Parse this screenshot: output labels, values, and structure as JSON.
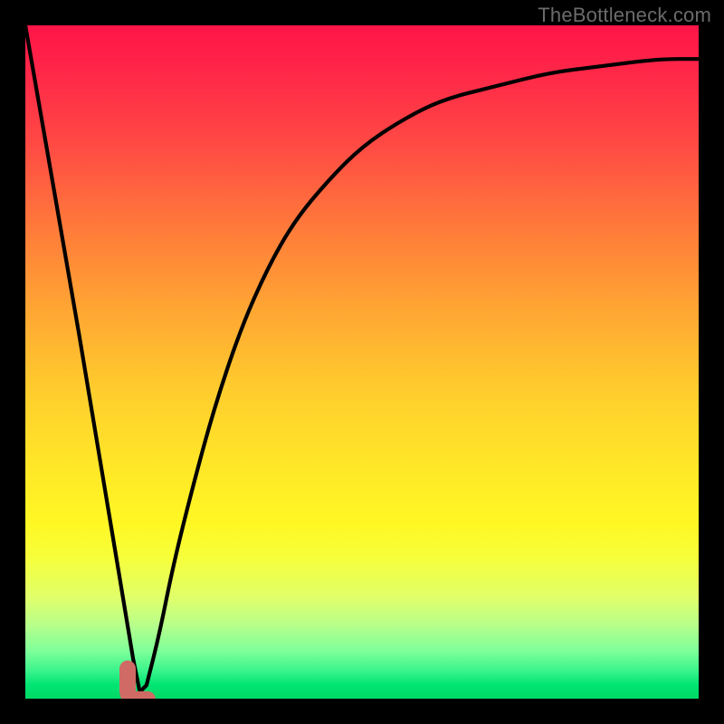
{
  "watermark": "TheBottleneck.com",
  "colors": {
    "page_bg": "#000000",
    "curve_stroke": "#000000",
    "marker_fill": "#cf6a64",
    "marker_stroke": "#cf6a64",
    "gradient_top": "#ff1448",
    "gradient_mid": "#ffe827",
    "gradient_bottom": "#00d864"
  },
  "chart_data": {
    "type": "line",
    "title": "",
    "xlabel": "",
    "ylabel": "",
    "xlim": [
      0,
      100
    ],
    "ylim": [
      0,
      100
    ],
    "grid": false,
    "legend": false,
    "series": [
      {
        "name": "bottleneck-curve",
        "x": [
          0,
          4,
          8,
          12,
          14,
          16,
          17,
          18,
          20,
          22,
          25,
          28,
          32,
          36,
          40,
          45,
          50,
          56,
          62,
          70,
          78,
          86,
          94,
          100
        ],
        "values": [
          100,
          77,
          54,
          30,
          18,
          6,
          1,
          2,
          10,
          20,
          32,
          43,
          55,
          64,
          71,
          77,
          82,
          86,
          89,
          91,
          93,
          94,
          95,
          95
        ]
      }
    ],
    "marker": {
      "name": "optimal-point",
      "shape": "J",
      "x": 16,
      "y": 1.5
    }
  }
}
